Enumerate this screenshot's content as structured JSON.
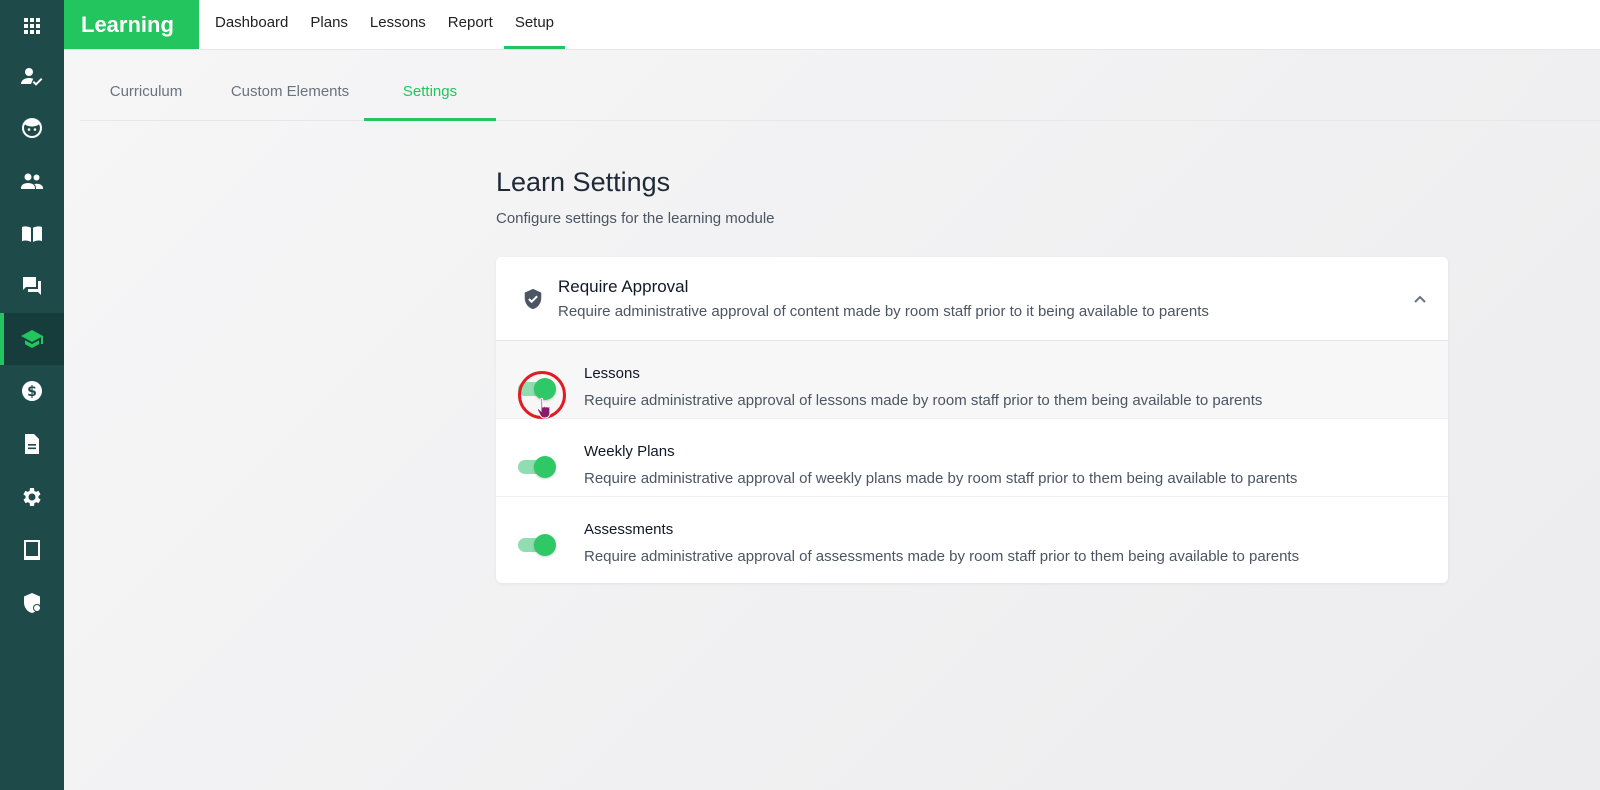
{
  "sidebar": {
    "items": [
      {
        "icon": "apps-grid-icon"
      },
      {
        "icon": "person-check-icon"
      },
      {
        "icon": "child-face-icon"
      },
      {
        "icon": "people-icon"
      },
      {
        "icon": "book-icon"
      },
      {
        "icon": "chat-icon"
      },
      {
        "icon": "school-icon",
        "active": true
      },
      {
        "icon": "dollar-icon"
      },
      {
        "icon": "document-icon"
      },
      {
        "icon": "gear-icon"
      },
      {
        "icon": "tablet-icon"
      },
      {
        "icon": "shield-lock-icon"
      }
    ]
  },
  "header": {
    "brand": "Learning",
    "nav": [
      "Dashboard",
      "Plans",
      "Lessons",
      "Report",
      "Setup"
    ],
    "active_nav": "Setup"
  },
  "tabs": {
    "items": [
      "Curriculum",
      "Custom Elements",
      "Settings"
    ],
    "active": "Settings"
  },
  "page": {
    "title": "Learn Settings",
    "subtitle": "Configure settings for the learning module"
  },
  "card": {
    "title": "Require Approval",
    "description": "Require administrative approval of content made by room staff prior to it being available to parents",
    "icon": "shield-check-icon",
    "collapse_icon": "chevron-up-icon",
    "rows": [
      {
        "title": "Lessons",
        "description": "Require administrative approval of lessons made by room staff prior to them being available to parents",
        "enabled": true
      },
      {
        "title": "Weekly Plans",
        "description": "Require administrative approval of weekly plans made by room staff prior to them being available to parents",
        "enabled": true
      },
      {
        "title": "Assessments",
        "description": "Require administrative approval of assessments made by room staff prior to them being available to parents",
        "enabled": true
      }
    ]
  },
  "colors": {
    "sidebar": "#1f4a4a",
    "accent": "#22c55e",
    "toggle_track": "#8fddb0",
    "cursor_ring": "#e11d24"
  }
}
